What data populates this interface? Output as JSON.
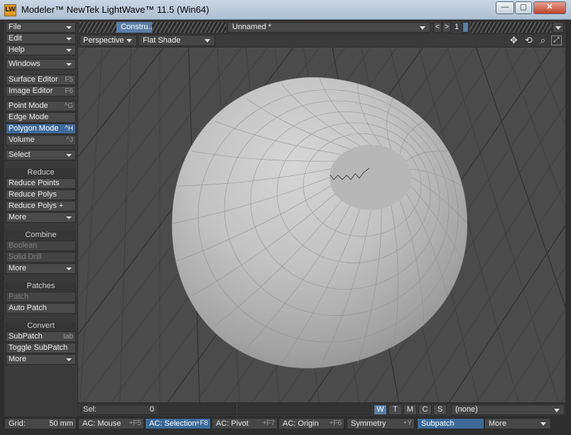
{
  "window": {
    "title": "Modeler™ NewTek LightWave™ 11.5 (Win64)",
    "icon_text": "LW",
    "minimize": "—",
    "maximize": "▢",
    "close": "✕"
  },
  "sidebar": {
    "file": "File",
    "edit": "Edit",
    "help": "Help",
    "windows": "Windows",
    "surface_editor": {
      "label": "Surface Editor",
      "shortcut": "F5"
    },
    "image_editor": {
      "label": "Image Editor",
      "shortcut": "F6"
    },
    "point_mode": {
      "label": "Point Mode",
      "shortcut": "^G"
    },
    "edge_mode": {
      "label": "Edge Mode",
      "shortcut": ""
    },
    "polygon_mode": {
      "label": "Polygon Mode",
      "shortcut": "^H"
    },
    "volume": {
      "label": "Volume",
      "shortcut": "^J"
    },
    "select": "Select",
    "reduce": {
      "header": "Reduce",
      "reduce_points": "Reduce Points",
      "reduce_polys": "Reduce Polys",
      "reduce_polys_plus": "Reduce Polys +",
      "more": "More"
    },
    "combine": {
      "header": "Combine",
      "boolean": "Boolean",
      "solid_drill": "Solid Drill",
      "more": "More"
    },
    "patches": {
      "header": "Patches",
      "patch": "Patch",
      "auto_patch": "Auto Patch"
    },
    "convert": {
      "header": "Convert",
      "subpatch": "SubPatch",
      "subpatch_shortcut": "tab",
      "toggle_subpatch": "Toggle SubPatch",
      "more": "More"
    }
  },
  "topbar": {
    "tab": "Constru...",
    "object": "Unnamed *",
    "prev": "<",
    "next": ">",
    "layer": "1"
  },
  "viewport_bar": {
    "view": "Perspective",
    "shading": "Flat Shade",
    "icons": [
      "move-icon",
      "rotate-icon",
      "zoom-icon",
      "maximize-icon"
    ]
  },
  "status": {
    "sel_label": "Sel:",
    "sel_value": "0",
    "w": "W",
    "t": "T",
    "m": "M",
    "c": "C",
    "s": "S",
    "symmetry_target": "(none)"
  },
  "bottom": {
    "grid_label": "Grid:",
    "grid_value": "50 mm",
    "ac_mouse": {
      "label": "AC: Mouse",
      "shortcut": "+F5"
    },
    "ac_selection": {
      "label": "AC: Selection",
      "shortcut": "+F8"
    },
    "ac_pivot": {
      "label": "AC: Pivot",
      "shortcut": "+F7"
    },
    "ac_origin": {
      "label": "AC: Origin",
      "shortcut": "+F6"
    },
    "symmetry": {
      "label": "Symmetry",
      "shortcut": "+Y"
    },
    "subpatch": "Subpatch",
    "more": "More"
  },
  "colors": {
    "accent": "#3d6a99",
    "tab_active": "#5a7ea8",
    "background": "#3c3c3c",
    "viewport": "#4a4a4a"
  }
}
